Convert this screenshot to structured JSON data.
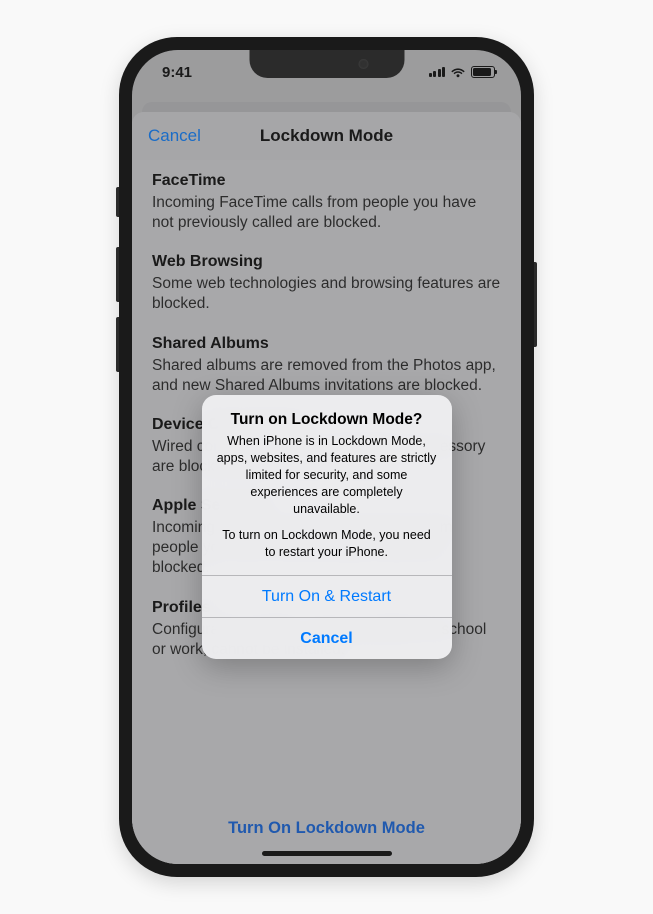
{
  "statusBar": {
    "time": "9:41"
  },
  "sheet": {
    "nav": {
      "cancel": "Cancel",
      "title": "Lockdown Mode"
    },
    "sections": [
      {
        "title": "FaceTime",
        "body": "Incoming FaceTime calls from people you have not previously called are blocked."
      },
      {
        "title": "Web Browsing",
        "body": "Some web technologies and browsing features are blocked."
      },
      {
        "title": "Shared Albums",
        "body": "Shared albums are removed from the Photos app, and new Shared Albums invitations are blocked."
      },
      {
        "title": "Device Connections",
        "body": "Wired connections with a computer or accessory are blocked when iPhone is locked."
      },
      {
        "title": "Apple Services",
        "body": "Incoming invitations for Apple Services from people you have not previously invited are blocked."
      },
      {
        "title": "Profiles",
        "body": "Configuration profiles, such as profiles for school or work, cannot be installed."
      }
    ],
    "primaryAction": "Turn On Lockdown Mode"
  },
  "alert": {
    "title": "Turn on Lockdown Mode?",
    "message1": "When iPhone is in Lockdown Mode, apps, websites, and features are strictly limited for security, and some experiences are completely unavailable.",
    "message2": "To turn on Lockdown Mode, you need to restart your iPhone.",
    "primary": "Turn On & Restart",
    "cancel": "Cancel"
  }
}
